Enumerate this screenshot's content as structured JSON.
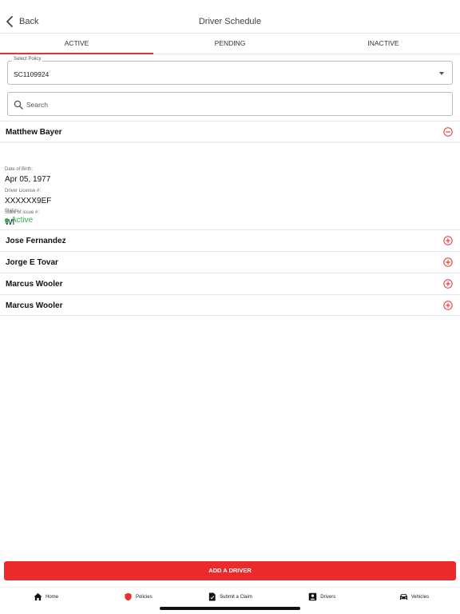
{
  "header": {
    "back_label": "Back",
    "title": "Driver Schedule"
  },
  "tabs": [
    {
      "label": "ACTIVE",
      "active": true
    },
    {
      "label": "PENDING",
      "active": false
    },
    {
      "label": "INACTIVE",
      "active": false
    }
  ],
  "policy_select": {
    "label": "Select Policy",
    "value": "SC1109924"
  },
  "search": {
    "placeholder": "Search"
  },
  "drivers": [
    {
      "name": "Matthew Bayer",
      "expanded": true,
      "details": {
        "dob_label": "Date of Birth:",
        "dob": "Apr 05, 1977",
        "license_label": "Driver License #:",
        "license": "XXXXXX9EF",
        "state_label": "State of issue #:",
        "state": "WI",
        "status_label": "Status:",
        "status": "Active"
      }
    },
    {
      "name": "Jose Fernandez",
      "expanded": false
    },
    {
      "name": "Jorge E Tovar",
      "expanded": false
    },
    {
      "name": "Marcus Wooler",
      "expanded": false
    },
    {
      "name": "Marcus Wooler",
      "expanded": false
    }
  ],
  "add_button": {
    "label": "ADD A DRIVER"
  },
  "bottom_nav": [
    {
      "label": "Home",
      "icon": "home-icon"
    },
    {
      "label": "Policies",
      "icon": "shield-icon"
    },
    {
      "label": "Submit a Claim",
      "icon": "document-icon"
    },
    {
      "label": "Drivers",
      "icon": "person-icon"
    },
    {
      "label": "Vehicles",
      "icon": "car-icon"
    }
  ],
  "colors": {
    "accent": "#ea2b2b",
    "active_status": "#2fb24b"
  }
}
